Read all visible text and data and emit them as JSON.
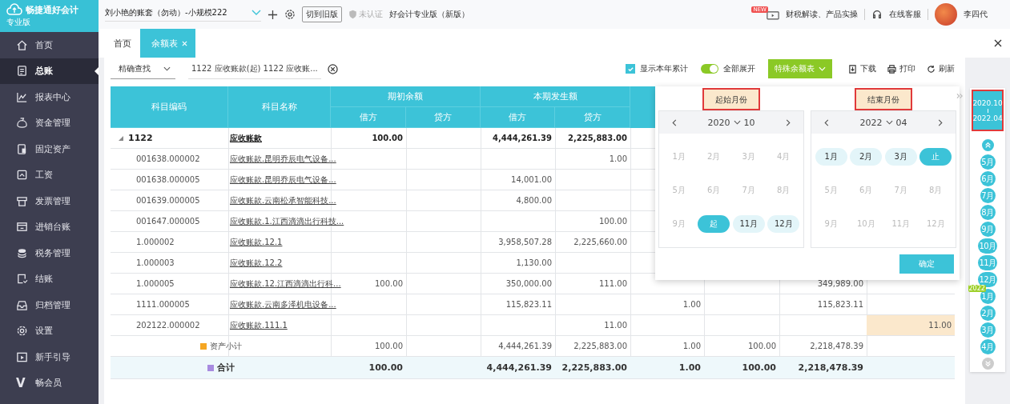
{
  "app": {
    "logo": "畅捷通好会计",
    "edition": "专业版"
  },
  "sidebar": {
    "items": [
      {
        "label": "首页",
        "selected": false
      },
      {
        "label": "总账",
        "selected": true
      },
      {
        "label": "报表中心",
        "selected": false
      },
      {
        "label": "资金管理",
        "selected": false
      },
      {
        "label": "固定资产",
        "selected": false
      },
      {
        "label": "工资",
        "selected": false
      },
      {
        "label": "发票管理",
        "selected": false
      },
      {
        "label": "进销台账",
        "selected": false
      },
      {
        "label": "税务管理",
        "selected": false
      },
      {
        "label": "结账",
        "selected": false
      },
      {
        "label": "归档管理",
        "selected": false
      },
      {
        "label": "设置",
        "selected": false
      },
      {
        "label": "新手引导",
        "selected": false
      },
      {
        "label": "畅会员",
        "selected": false,
        "glyph": "V"
      }
    ]
  },
  "topbar": {
    "account": "刘小艳的账套（勿动）-小规模222",
    "switch_button": "切到旧版",
    "cert_status": "未认证",
    "product": "好会计专业版（新版）",
    "news_badge": "NEW",
    "news": "财税解读、产品实操",
    "support": "在线客服",
    "user": "李四代"
  },
  "tabs": [
    {
      "label": "首页",
      "selected": false,
      "closable": false
    },
    {
      "label": "余额表",
      "selected": true,
      "closable": true
    }
  ],
  "toolbar": {
    "search_mode": "精确查找",
    "filter": "1122 应收账款(起) 1122 应收账...",
    "show_year_total": {
      "label": "显示本年累计",
      "checked": true
    },
    "expand_all": {
      "label": "全部展开",
      "on": true
    },
    "special_button": "特殊余额表",
    "actions": [
      "下载",
      "打印",
      "刷新"
    ]
  },
  "table": {
    "columns": [
      "科目编码",
      "科目名称"
    ],
    "groups": [
      {
        "label": "期初余额",
        "columns": [
          "借方",
          "贷方"
        ]
      },
      {
        "label": "本期发生额",
        "columns": [
          "借方",
          "贷方"
        ]
      }
    ],
    "rows": [
      {
        "kind": "parent",
        "code": "1122",
        "name": "应收账款",
        "expanded": true,
        "cells": [
          "100.00",
          null,
          "4,444,261.39",
          "2,225,883.00"
        ]
      },
      {
        "kind": "child",
        "code": "001638.000002",
        "name": "应收账款.昆明乔辰电气设备...",
        "cells": [
          null,
          null,
          null,
          "1.00"
        ]
      },
      {
        "kind": "child",
        "code": "001638.000005",
        "name": "应收账款.昆明乔辰电气设备...",
        "cells": [
          null,
          null,
          "14,001.00",
          null
        ]
      },
      {
        "kind": "child",
        "code": "001639.000005",
        "name": "应收账款.云南松承智能科技...",
        "cells": [
          null,
          null,
          "4,800.00",
          null
        ]
      },
      {
        "kind": "child",
        "code": "001647.000005",
        "name": "应收账款.1.江西滴滴出行科技...",
        "cells": [
          null,
          null,
          null,
          "100.00"
        ]
      },
      {
        "kind": "child",
        "code": "1.000002",
        "name": "应收账款.12.1",
        "cells": [
          null,
          null,
          "3,958,507.28",
          "2,225,660.00"
        ]
      },
      {
        "kind": "child",
        "code": "1.000003",
        "name": "应收账款.12.2",
        "cells": [
          null,
          null,
          "1,130.00",
          null
        ]
      },
      {
        "kind": "child",
        "code": "1.000005",
        "name": "应收账款.12.江西滴滴出行科...",
        "cells": [
          "100.00",
          null,
          "350,000.00",
          "111.00",
          null,
          null,
          "349,989.00",
          null
        ]
      },
      {
        "kind": "child",
        "code": "1111.000005",
        "name": "应收账款.云南多泽机电设备...",
        "cells": [
          null,
          null,
          "115,823.11",
          null,
          "1.00",
          null,
          "115,823.11",
          null
        ]
      },
      {
        "kind": "child",
        "code": "202122.000002",
        "name": "应收账款.111.1",
        "highlight_last": true,
        "cells": [
          null,
          null,
          null,
          "11.00",
          null,
          null,
          null,
          "11.00"
        ]
      },
      {
        "kind": "subtotal",
        "label": "资产小计",
        "cells": [
          "100.00",
          null,
          "4,444,261.39",
          "2,225,883.00",
          "1.00",
          "100.00",
          "2,218,478.39",
          null
        ]
      },
      {
        "kind": "total",
        "label": "合计",
        "cells": [
          "100.00",
          null,
          "4,444,261.39",
          "2,225,883.00",
          "1.00",
          "100.00",
          "2,218,478.39",
          null
        ]
      }
    ]
  },
  "month_picker": {
    "panels": [
      {
        "label": "起始月份",
        "highlighted": true,
        "year": "2020",
        "month": "10",
        "months": [
          {
            "label": "1月",
            "disabled": true,
            "in_range": false,
            "selected": false
          },
          {
            "label": "2月",
            "disabled": true,
            "in_range": false,
            "selected": false
          },
          {
            "label": "3月",
            "disabled": true,
            "in_range": false,
            "selected": false
          },
          {
            "label": "4月",
            "disabled": true,
            "in_range": false,
            "selected": false
          },
          {
            "label": "5月",
            "disabled": true,
            "in_range": false,
            "selected": false
          },
          {
            "label": "6月",
            "disabled": true,
            "in_range": false,
            "selected": false
          },
          {
            "label": "7月",
            "disabled": true,
            "in_range": false,
            "selected": false
          },
          {
            "label": "8月",
            "disabled": true,
            "in_range": false,
            "selected": false
          },
          {
            "label": "9月",
            "disabled": true,
            "in_range": false,
            "selected": false
          },
          {
            "label": "起",
            "disabled": false,
            "in_range": false,
            "selected": true
          },
          {
            "label": "11月",
            "disabled": false,
            "in_range": true,
            "selected": false
          },
          {
            "label": "12月",
            "disabled": false,
            "in_range": true,
            "selected": false
          }
        ]
      },
      {
        "label": "结束月份",
        "highlighted": true,
        "year": "2022",
        "month": "04",
        "months": [
          {
            "label": "1月",
            "disabled": false,
            "in_range": true,
            "selected": false
          },
          {
            "label": "2月",
            "disabled": false,
            "in_range": true,
            "selected": false
          },
          {
            "label": "3月",
            "disabled": false,
            "in_range": true,
            "selected": false
          },
          {
            "label": "止",
            "disabled": false,
            "in_range": false,
            "selected": true
          },
          {
            "label": "5月",
            "disabled": true,
            "in_range": false,
            "selected": false
          },
          {
            "label": "6月",
            "disabled": true,
            "in_range": false,
            "selected": false
          },
          {
            "label": "7月",
            "disabled": true,
            "in_range": false,
            "selected": false
          },
          {
            "label": "8月",
            "disabled": true,
            "in_range": false,
            "selected": false
          },
          {
            "label": "9月",
            "disabled": true,
            "in_range": false,
            "selected": false
          },
          {
            "label": "10月",
            "disabled": true,
            "in_range": false,
            "selected": false
          },
          {
            "label": "11月",
            "disabled": true,
            "in_range": false,
            "selected": false
          },
          {
            "label": "12月",
            "disabled": true,
            "in_range": false,
            "selected": false
          }
        ]
      }
    ],
    "confirm": "确定"
  },
  "period_strip": {
    "from": "2020.10",
    "to": "2022.04",
    "highlighted": true,
    "months": [
      {
        "label": "5月"
      },
      {
        "label": "6月"
      },
      {
        "label": "7月"
      },
      {
        "label": "8月"
      },
      {
        "label": "9月"
      },
      {
        "label": "10月"
      },
      {
        "label": "11月"
      },
      {
        "label": "12月"
      },
      {
        "label": "1月",
        "year_tag": "2022"
      },
      {
        "label": "2月"
      },
      {
        "label": "3月"
      },
      {
        "label": "4月"
      }
    ]
  }
}
